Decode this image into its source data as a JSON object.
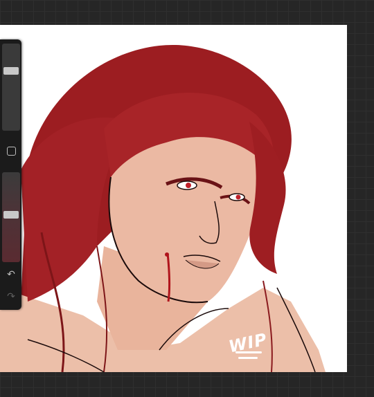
{
  "canvas": {
    "watermark_text": "WIP",
    "artwork_description_icon": "artwork-icon"
  },
  "sidebar": {
    "brush_size": {
      "value": 0.7
    },
    "opacity": {
      "value": 0.5
    },
    "modify_icon": "square-icon",
    "undo_icon": "undo-icon",
    "redo_icon": "redo-icon",
    "undo_glyph": "↶",
    "redo_glyph": "↷"
  },
  "colors": {
    "background": "#262626",
    "hair": "#9e1e22",
    "skin": "#ebb9a3",
    "panel": "#1b1b1b"
  }
}
